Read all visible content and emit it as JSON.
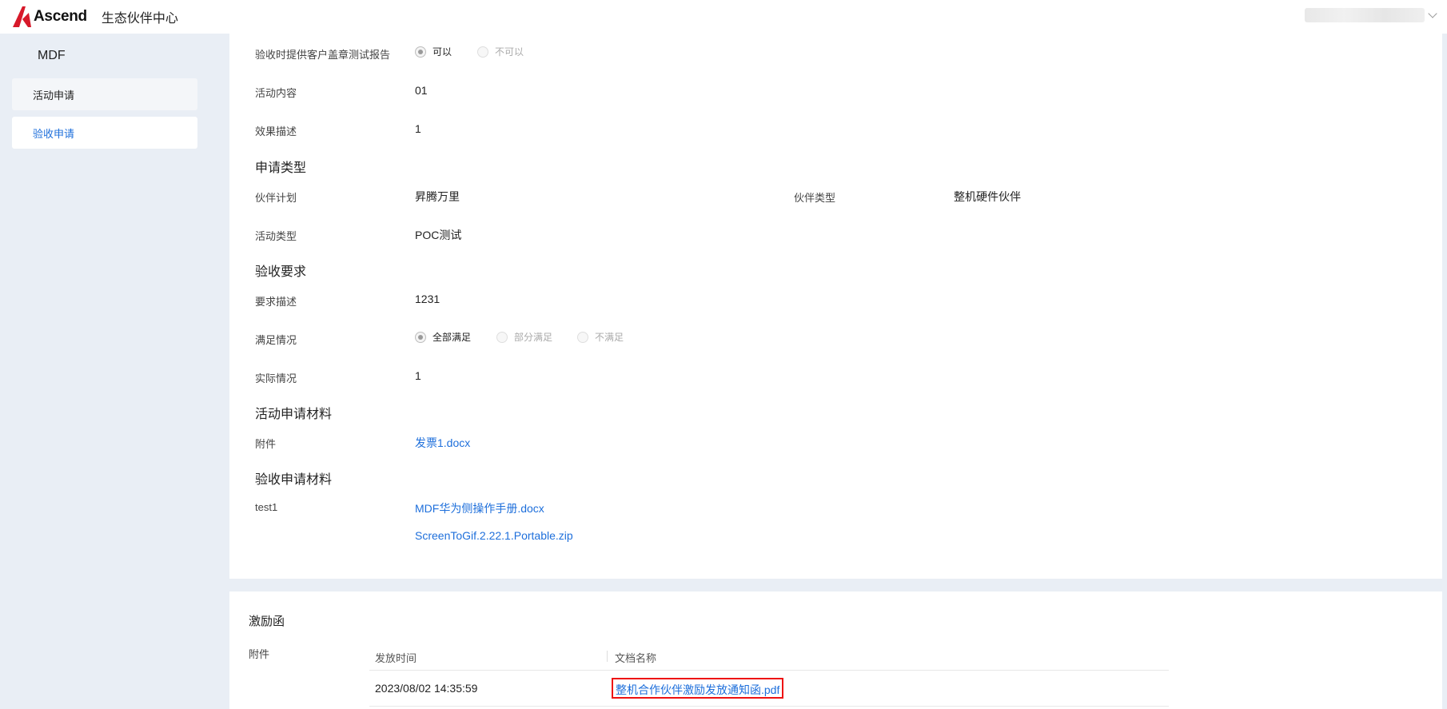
{
  "header": {
    "logo_text": "Ascend",
    "app_title": "生态伙伴中心"
  },
  "sidebar": {
    "title": "MDF",
    "items": [
      {
        "label": "活动申请"
      },
      {
        "label": "验收申请",
        "active": true
      }
    ]
  },
  "form": {
    "stamp_report": {
      "label": "验收时提供客户盖章测试报告",
      "options": [
        "可以",
        "不可以"
      ],
      "selected": "可以"
    },
    "activity_content": {
      "label": "活动内容",
      "value": "01"
    },
    "effect_desc": {
      "label": "效果描述",
      "value": "1"
    },
    "apply_type": {
      "title": "申请类型",
      "partner_plan": {
        "label": "伙伴计划",
        "value": "昇腾万里"
      },
      "partner_type": {
        "label": "伙伴类型",
        "value": "整机硬件伙伴"
      },
      "activity_type": {
        "label": "活动类型",
        "value": "POC测试"
      }
    },
    "acceptance_req": {
      "title": "验收要求",
      "req_desc": {
        "label": "要求描述",
        "value": "1231"
      },
      "satisfaction": {
        "label": "满足情况",
        "options": [
          "全部满足",
          "部分满足",
          "不满足"
        ],
        "selected": "全部满足"
      },
      "actual": {
        "label": "实际情况",
        "value": "1"
      }
    },
    "activity_materials": {
      "title": "活动申请材料",
      "attach_label": "附件",
      "files": [
        "发票1.docx"
      ]
    },
    "acceptance_materials": {
      "title": "验收申请材料",
      "item_label": "test1",
      "files": [
        "MDF华为侧操作手册.docx",
        "ScreenToGif.2.22.1.Portable.zip"
      ]
    }
  },
  "incentive": {
    "title": "激励函",
    "attach_label": "附件",
    "columns": [
      "发放时间",
      "文档名称"
    ],
    "rows": [
      {
        "time": "2023/08/02 14:35:59",
        "doc": "整机合作伙伴激励发放通知函.pdf"
      }
    ]
  },
  "colors": {
    "link": "#1e6fdb",
    "highlight_border": "#ee1111",
    "page_bg": "#e9eef5"
  }
}
